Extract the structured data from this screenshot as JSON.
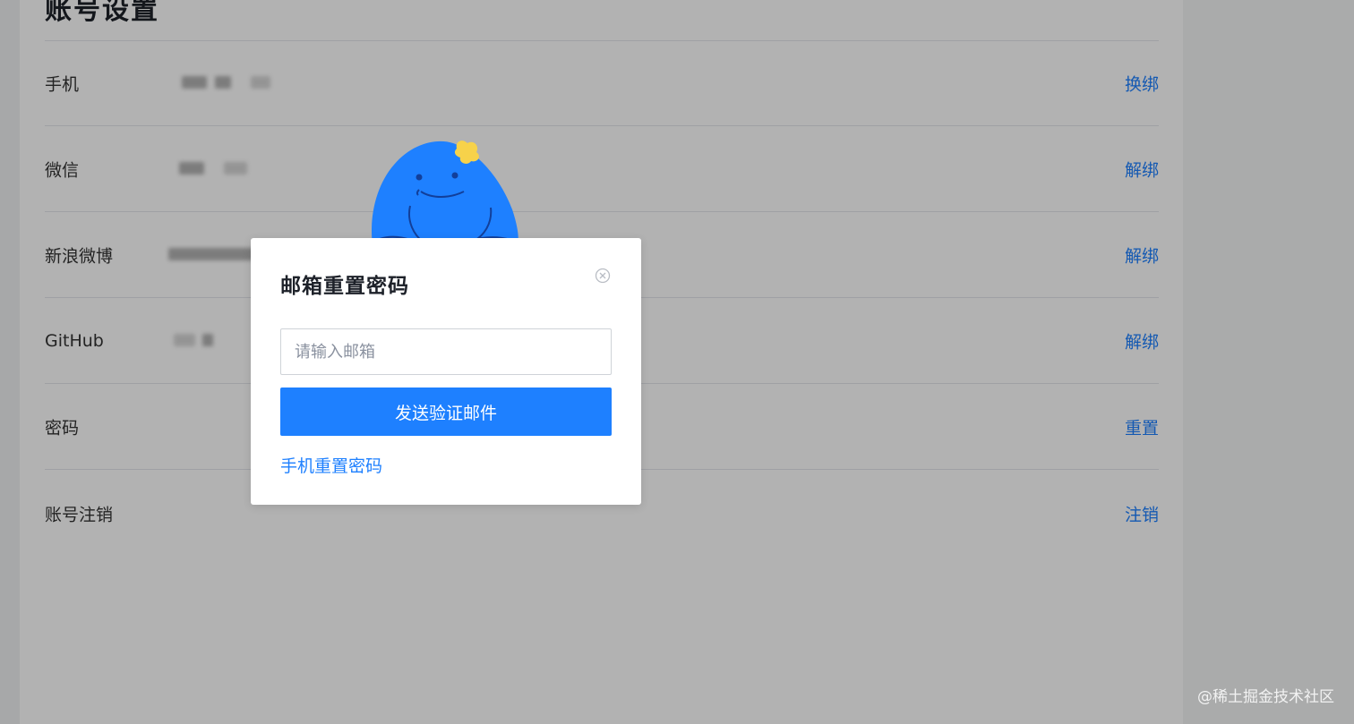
{
  "page": {
    "title": "账号设置",
    "rows": [
      {
        "label": "手机",
        "action": "换绑"
      },
      {
        "label": "微信",
        "action": "解绑"
      },
      {
        "label": "新浪微博",
        "action": "解绑"
      },
      {
        "label": "GitHub",
        "action": "解绑"
      },
      {
        "label": "密码",
        "action": "重置"
      },
      {
        "label": "账号注销",
        "action": "注销"
      }
    ]
  },
  "modal": {
    "title": "邮箱重置密码",
    "email_placeholder": "请输入邮箱",
    "email_value": "",
    "send_button": "发送验证邮件",
    "phone_reset_link": "手机重置密码"
  },
  "watermark": "@稀土掘金技术社区",
  "colors": {
    "accent": "#1e80ff",
    "mascot_body": "#1e80ff",
    "mascot_flower": "#f7d24a"
  }
}
